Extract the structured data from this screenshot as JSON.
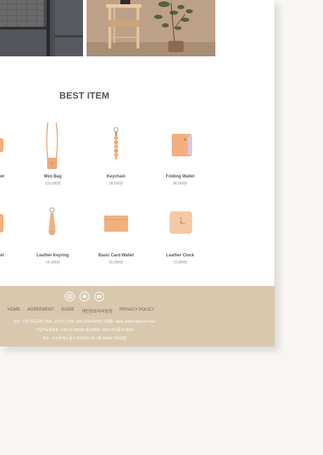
{
  "section": {
    "title": "BEST ITEM"
  },
  "products": [
    {
      "name": "allet",
      "price": ""
    },
    {
      "name": "Mini Bag",
      "price": "132,000원"
    },
    {
      "name": "Keychain",
      "price": "28,000원"
    },
    {
      "name": "Folding Wallet",
      "price": "86,000원"
    },
    {
      "name": "allet",
      "price": ""
    },
    {
      "name": "Leather Keyring",
      "price": "16,000원"
    },
    {
      "name": "Basic Card Wallet",
      "price": "65,000원"
    },
    {
      "name": "Leather Clock",
      "price": "72,000원"
    }
  ],
  "footer": {
    "nav": [
      "HOME",
      "AGREEMENT",
      "GUIDE",
      "개인정보처리방침",
      "PRIVACY POLICY"
    ],
    "info": [
      "상호 : 디어가죽공방 | 대표 : 김수아 | 전화 : 010-1234-5678 | 이메일 : dear_leather@naver.com",
      "사업자등록번호 : 132-12-00563 | 통신판매 : 2021-부산동구-0513",
      "주소 : 부산광역시 동구 중앙대로 26, 1층 DEAR 가죽공방"
    ]
  },
  "icons": [
    "instagram-icon",
    "chat-icon",
    "youtube-icon"
  ],
  "colors": {
    "footer_bg": "#d9c8ae",
    "leather": "#f2b07f",
    "page_bg": "#f8f6f3"
  }
}
